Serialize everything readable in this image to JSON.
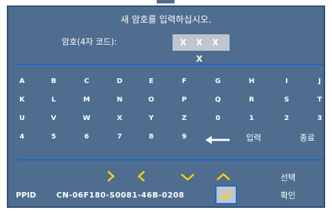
{
  "dialog": {
    "title": "새 암호를 입력하십시오.",
    "password_label": "암호(4자 코드):",
    "password_value": "X X X X"
  },
  "keypad": {
    "row1": [
      "A",
      "B",
      "C",
      "D",
      "E",
      "F",
      "G",
      "H",
      "I",
      "J"
    ],
    "row2": [
      "K",
      "L",
      "M",
      "N",
      "O",
      "P",
      "Q",
      "R",
      "S",
      "T"
    ],
    "row3": [
      "U",
      "V",
      "W",
      "X",
      "Y",
      "Z",
      "0",
      "1",
      "2",
      "3"
    ],
    "row4": [
      "4",
      "5",
      "6",
      "7",
      "8",
      "9"
    ],
    "backspace_icon": "left-arrow-icon",
    "enter_label": "입력",
    "exit_label": "종료"
  },
  "footer": {
    "select_label": "선택",
    "confirm_label": "확인",
    "ppid_label": "PPID",
    "ppid_value": "CN-06F180-S0081-46B-0208",
    "confirm_icon": "checkmark-icon"
  },
  "colors": {
    "panel": "#4f6d8f",
    "divider": "#1f64cf",
    "accent_yellow": "#ffd400",
    "text": "#ffffff",
    "field": "#bfc6cf"
  }
}
